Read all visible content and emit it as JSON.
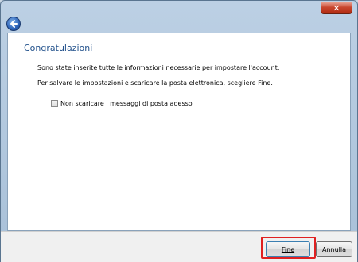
{
  "window": {
    "close_label": "✕",
    "back_icon": "back-arrow-icon"
  },
  "main": {
    "heading": "Congratulazioni",
    "line1": "Sono state inserite tutte le informazioni necessarie per impostare l'account.",
    "line2": "Per salvare le impostazioni e scaricare la posta elettronica, scegliere Fine.",
    "option_label": "Non scaricare i messaggi di posta adesso",
    "option_checked": false
  },
  "footer": {
    "finish_label": "Fine",
    "cancel_label": "Annulla"
  },
  "colors": {
    "heading": "#1f4f8a",
    "highlight": "#e02020"
  }
}
